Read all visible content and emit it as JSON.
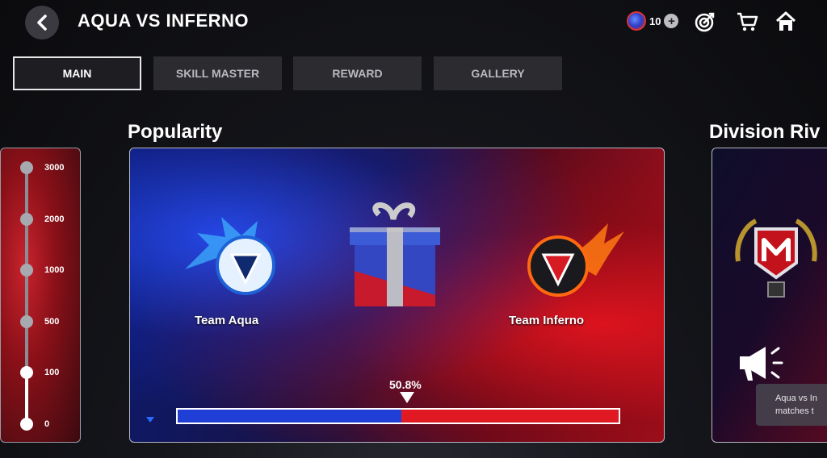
{
  "header": {
    "title": "AQUA VS INFERNO",
    "currency_value": "10",
    "icons": [
      "back-icon",
      "coin-icon",
      "plus-icon",
      "target-icon",
      "cart-icon",
      "home-icon"
    ]
  },
  "tabs": [
    {
      "label": "MAIN",
      "active": true
    },
    {
      "label": "SKILL MASTER",
      "active": false
    },
    {
      "label": "REWARD",
      "active": false
    },
    {
      "label": "GALLERY",
      "active": false
    }
  ],
  "progress_track": {
    "ticks": [
      "3000",
      "2000",
      "1000",
      "500",
      "100",
      "0"
    ],
    "current_level": "100"
  },
  "popularity": {
    "title": "Popularity",
    "team_left": "Team Aqua",
    "team_right": "Team Inferno",
    "percent_label": "50.8%",
    "aqua_share": 0.508
  },
  "division": {
    "title": "Division Riv",
    "tooltip_line1": "Aqua vs In",
    "tooltip_line2": "matches t"
  },
  "colors": {
    "aqua": "#1f3fd6",
    "inferno": "#e01923"
  }
}
